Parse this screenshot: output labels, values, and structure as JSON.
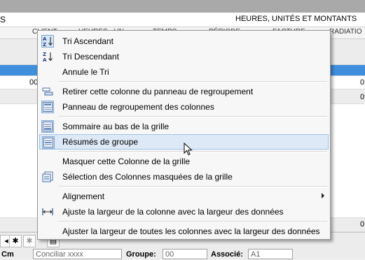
{
  "header": {
    "left_text": "S",
    "right_text": "HEURES, UNITÉS  ET MONTANTS",
    "columns": [
      "CLIENT",
      "HEURES - UN",
      "TEMPS",
      "PÉRIODE",
      "FACTURE",
      "RADIATIO"
    ]
  },
  "grid": {
    "row1_left": "00",
    "row1_right": "0",
    "row2_right": "0",
    "bottom_right": "0"
  },
  "context_menu": {
    "items": [
      {
        "label": "Tri Ascendant",
        "icon": "sort-ascending-icon"
      },
      {
        "label": "Tri Descendant",
        "icon": "sort-descending-icon"
      },
      {
        "label": "Annule le Tri",
        "icon": ""
      },
      {
        "label": "Retirer cette colonne du panneau de regroupement",
        "icon": "ungroup-column-icon"
      },
      {
        "label": "Panneau de regroupement des colonnes",
        "icon": "group-panel-icon"
      },
      {
        "label": "Sommaire au bas de la grille",
        "icon": "grid-footer-icon"
      },
      {
        "label": "Résumés de groupe",
        "icon": "group-summary-icon"
      },
      {
        "label": "Masquer cette Colonne de la grille",
        "icon": ""
      },
      {
        "label": "Sélection des Colonnes masquées de la grille",
        "icon": "column-chooser-icon"
      },
      {
        "label": "Alignement",
        "icon": ""
      },
      {
        "label": "Ajuste la largeur de la colonne avec la largeur des données",
        "icon": "best-fit-icon"
      },
      {
        "label": "Ajuster la largeur de toutes les colonnes avec la largeur des données",
        "icon": ""
      }
    ]
  },
  "form": {
    "field1_label": "Cm",
    "field1_value": "Conciliar xxxx",
    "groupe_label": "Groupe:",
    "groupe_value": "00",
    "associe_label": "Associé:",
    "associe_value": "A1"
  },
  "colors": {
    "menu_highlight": "#dde9f6",
    "selected_row": "#3f8fdc"
  }
}
